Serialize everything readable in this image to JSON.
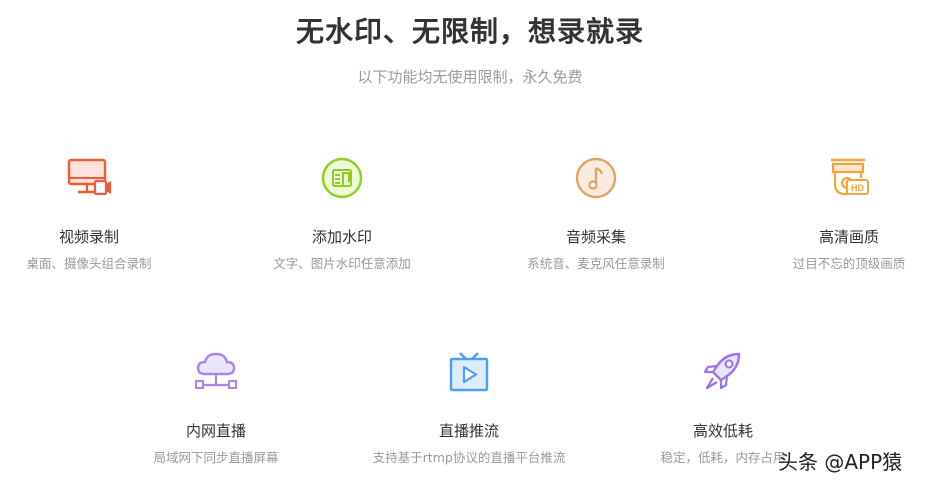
{
  "header": {
    "title": "无水印、无限制，想录就录",
    "subtitle": "以下功能均无使用限制，永久免费"
  },
  "features": [
    {
      "icon": "screen-camera-icon",
      "name": "视频录制",
      "desc": "桌面、摄像头组合录制",
      "color": "#f25a37"
    },
    {
      "icon": "watermark-stamp-icon",
      "name": "添加水印",
      "desc": "文字、图片水印任意添加",
      "color": "#8ccf1f"
    },
    {
      "icon": "music-note-icon",
      "name": "音频采集",
      "desc": "系统音、麦克风任意录制",
      "color": "#dda46a"
    },
    {
      "icon": "hd-camera-icon",
      "name": "高清画质",
      "desc": "过目不忘的顶级画质",
      "color": "#f5a43a"
    },
    {
      "icon": "cloud-network-icon",
      "name": "内网直播",
      "desc": "局域网下同步直播屏幕",
      "color": "#a885f0"
    },
    {
      "icon": "tv-play-icon",
      "name": "直播推流",
      "desc": "支持基于rtmp协议的直播平台推流",
      "color": "#4d9ff2"
    },
    {
      "icon": "rocket-icon",
      "name": "高效低耗",
      "desc": "稳定，低耗，内存占用",
      "color": "#9b73ea"
    }
  ],
  "watermark": {
    "text": "头条 @APP猿"
  }
}
